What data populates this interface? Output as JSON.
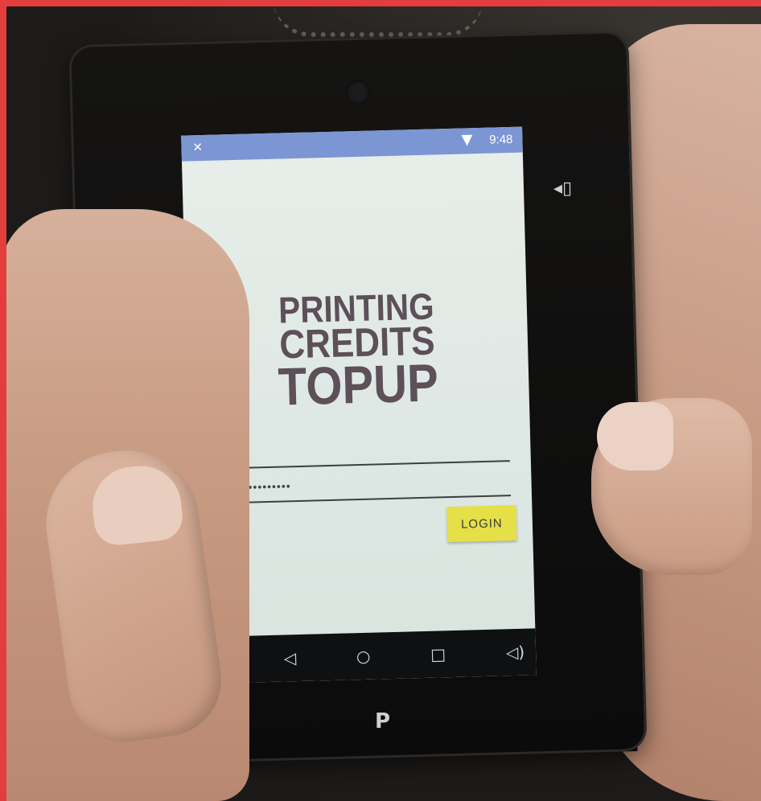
{
  "status_bar": {
    "left_icon": "notification-icon",
    "wifi_icon": "wifi-icon",
    "time": "9:48"
  },
  "app": {
    "title_line1": "PRINTING",
    "title_line2": "CREDITS",
    "title_line3": "TOPUP"
  },
  "login_form": {
    "username_value": "",
    "password_value": "••••••••••",
    "login_label": "LOGIN"
  },
  "nav_bar": {
    "icons": [
      "volume-down-icon",
      "back-icon",
      "home-icon",
      "recents-icon",
      "volume-up-icon"
    ]
  },
  "colors": {
    "status_bar": "#7c96d4",
    "login_button": "#e5e047",
    "title_text": "#5d5058",
    "screen_background": "#e8eeea"
  }
}
